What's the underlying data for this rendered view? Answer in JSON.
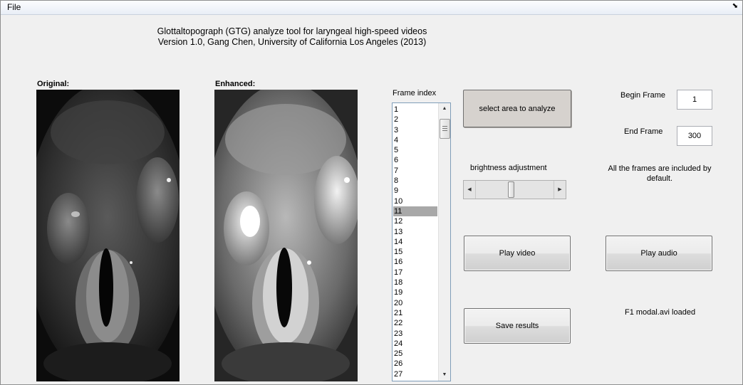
{
  "menu": {
    "file": "File",
    "restore_glyph": "⬊"
  },
  "title": {
    "line1": "Glottaltopograph (GTG) analyze tool for laryngeal high-speed videos",
    "line2": "Version 1.0, Gang Chen, University of California Los Angeles (2013)"
  },
  "panels": {
    "original_label": "Original:",
    "enhanced_label": "Enhanced:"
  },
  "frame_list": {
    "label": "Frame index",
    "items": [
      "1",
      "2",
      "3",
      "4",
      "5",
      "6",
      "7",
      "8",
      "9",
      "10",
      "11",
      "12",
      "13",
      "14",
      "15",
      "16",
      "17",
      "18",
      "19",
      "20",
      "21",
      "22",
      "23",
      "24",
      "25",
      "26",
      "27"
    ],
    "selected": "11"
  },
  "controls": {
    "select_area": "select area to analyze",
    "begin_frame_label": "Begin Frame",
    "begin_frame_value": "1",
    "end_frame_label": "End Frame",
    "end_frame_value": "300",
    "brightness_label": "brightness adjustment",
    "brightness_fraction": 0.45,
    "frames_note": "All the frames are included by default.",
    "play_video": "Play video",
    "play_audio": "Play audio",
    "save_results": "Save results",
    "status": "F1 modal.avi loaded"
  },
  "icons": {
    "scroll_up": "up-arrow",
    "scroll_down": "down-arrow",
    "slider_left": "left-arrow",
    "slider_right": "right-arrow"
  }
}
